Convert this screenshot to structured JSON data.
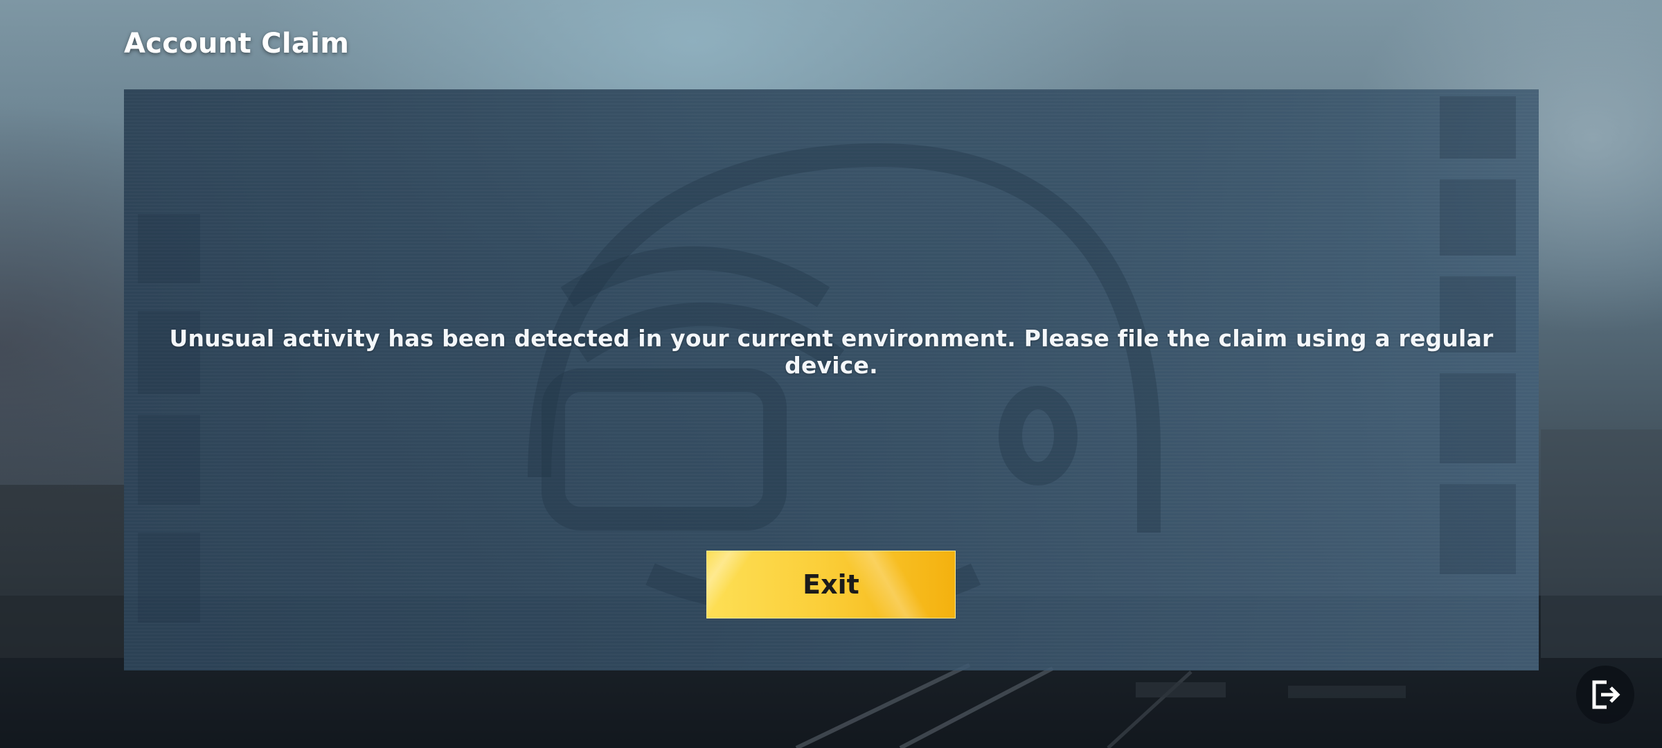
{
  "header": {
    "title": "Account Claim"
  },
  "dialog": {
    "message": "Unusual activity has been detected in your current environment. Please file the claim using a regular device.",
    "exit_label": "Exit"
  },
  "corner_button": {
    "icon": "logout-icon"
  },
  "colors": {
    "panel": "#2f4a60",
    "button_accent": "#f9c82a",
    "text": "#ffffff"
  }
}
